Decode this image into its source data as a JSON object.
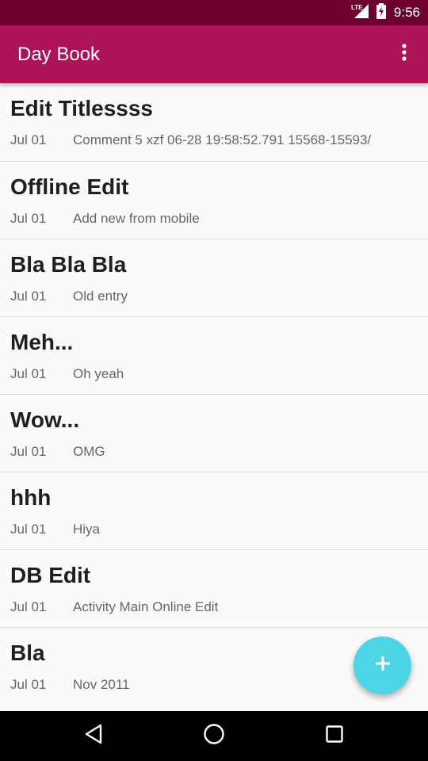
{
  "status_bar": {
    "network": "LTE",
    "time": "9:56"
  },
  "app_bar": {
    "title": "Day Book",
    "overflow_icon": "more-vert-icon"
  },
  "entries": [
    {
      "title": "Edit Titlessss",
      "date": "Jul 01",
      "comment": "Comment 5 xzf 06-28 19:58:52.791 15568-15593/"
    },
    {
      "title": "Offline Edit",
      "date": "Jul 01",
      "comment": "Add new from mobile"
    },
    {
      "title": "Bla Bla Bla",
      "date": "Jul 01",
      "comment": "Old entry"
    },
    {
      "title": "Meh...",
      "date": "Jul 01",
      "comment": "Oh yeah"
    },
    {
      "title": "Wow...",
      "date": "Jul 01",
      "comment": "OMG"
    },
    {
      "title": "hhh",
      "date": "Jul 01",
      "comment": "Hiya"
    },
    {
      "title": "DB Edit",
      "date": "Jul 01",
      "comment": "Activity Main Online Edit"
    },
    {
      "title": "Bla",
      "date": "Jul 01",
      "comment": "Nov 2011"
    }
  ],
  "fab": {
    "icon": "add-icon"
  },
  "nav_bar": {
    "back_icon": "back-icon",
    "home_icon": "home-icon",
    "recents_icon": "recents-icon"
  },
  "colors": {
    "status_bar": "#6e0030",
    "app_bar": "#ad1457",
    "fab": "#4dd5e6",
    "background": "#fafafa"
  }
}
